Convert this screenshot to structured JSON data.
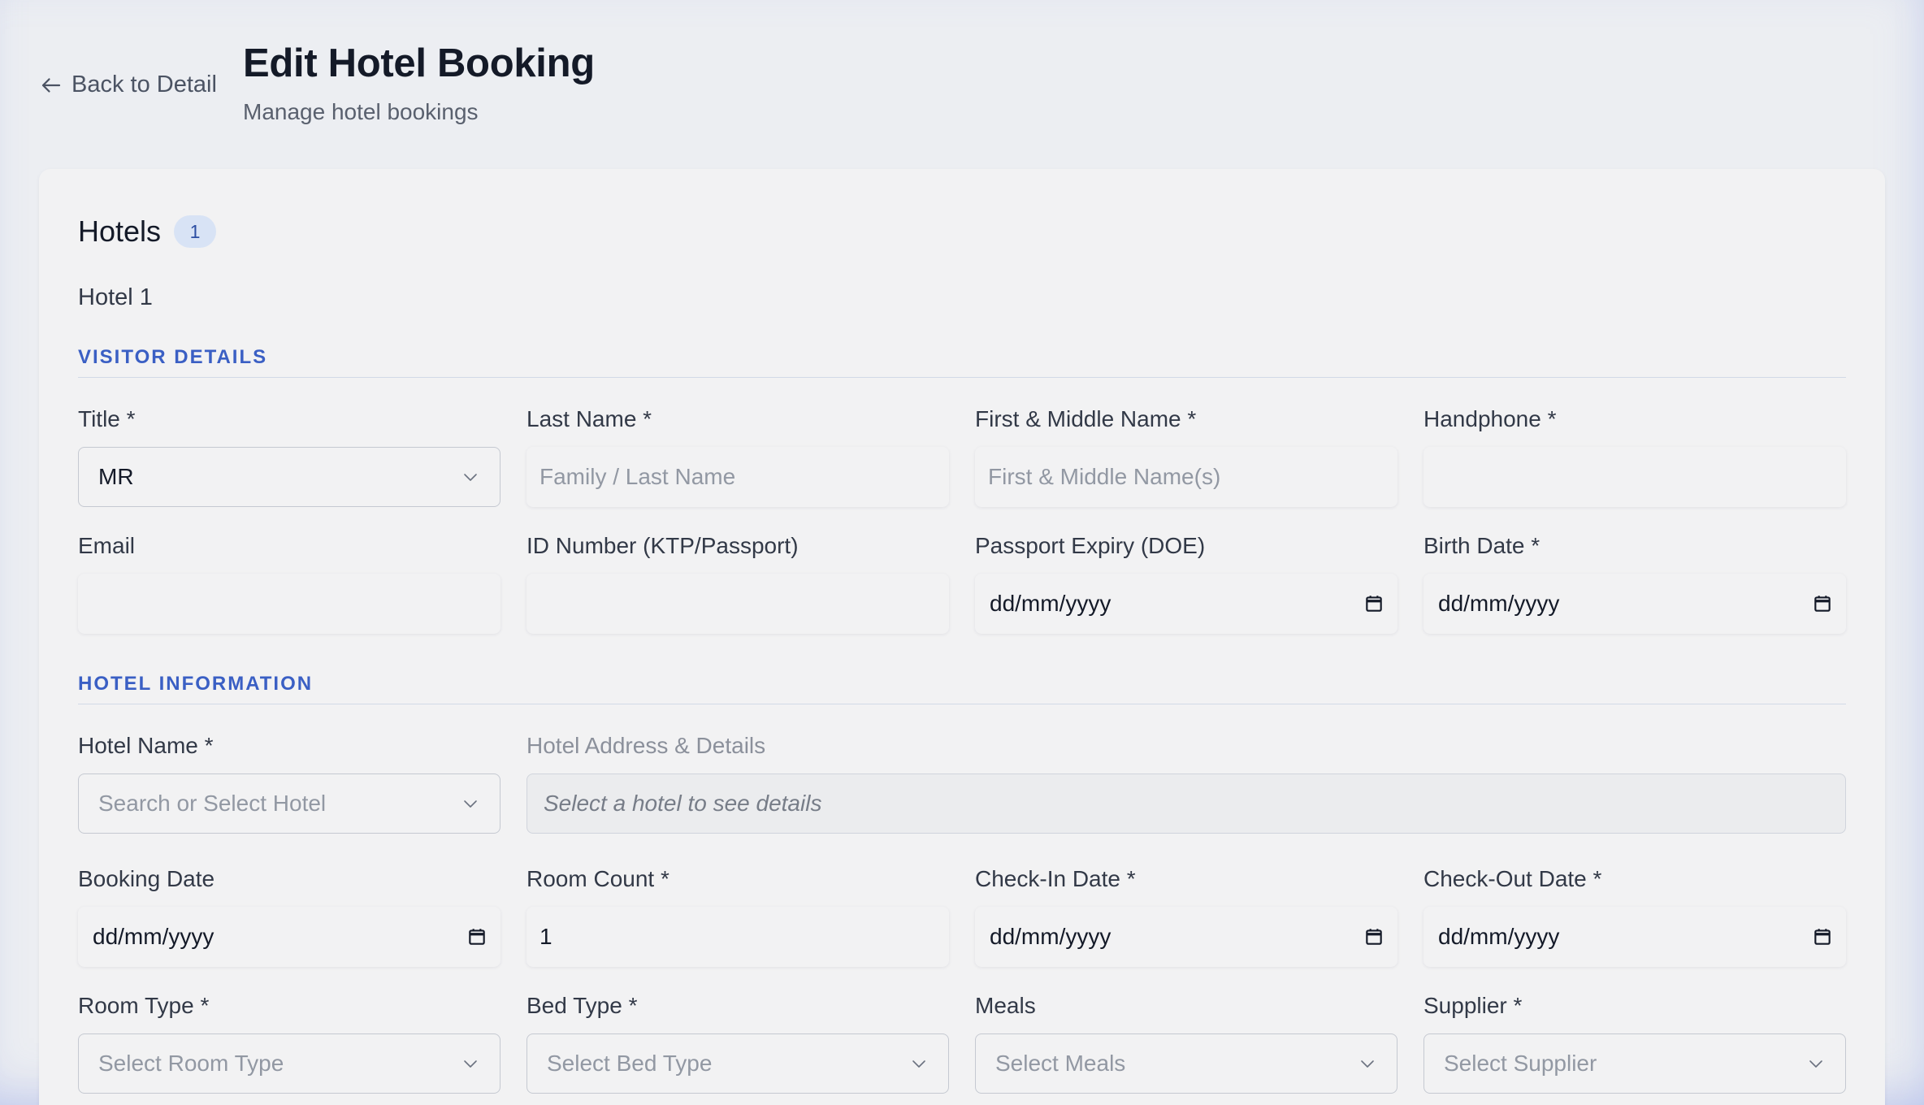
{
  "header": {
    "back_label": "Back to Detail",
    "title": "Edit Hotel Booking",
    "subtitle": "Manage hotel bookings"
  },
  "hotels": {
    "title": "Hotels",
    "count": "1",
    "item_label": "Hotel 1"
  },
  "visitor": {
    "heading": "VISITOR DETAILS",
    "title_label": "Title *",
    "title_value": "MR",
    "last_name_label": "Last Name *",
    "last_name_placeholder": "Family / Last Name",
    "first_name_label": "First & Middle Name *",
    "first_name_placeholder": "First & Middle Name(s)",
    "handphone_label": "Handphone *",
    "email_label": "Email",
    "id_label": "ID Number (KTP/Passport)",
    "passport_expiry_label": "Passport Expiry (DOE)",
    "passport_expiry_value": "dd/mm/yyyy",
    "birth_date_label": "Birth Date *",
    "birth_date_value": "dd/mm/yyyy"
  },
  "hotel_info": {
    "heading": "HOTEL INFORMATION",
    "hotel_name_label": "Hotel Name *",
    "hotel_name_placeholder": "Search or Select Hotel",
    "address_label": "Hotel Address & Details",
    "address_placeholder": "Select a hotel to see details",
    "booking_date_label": "Booking Date",
    "booking_date_value": "dd/mm/yyyy",
    "room_count_label": "Room Count *",
    "room_count_value": "1",
    "check_in_label": "Check-In Date *",
    "check_in_value": "dd/mm/yyyy",
    "check_out_label": "Check-Out Date *",
    "check_out_value": "dd/mm/yyyy",
    "room_type_label": "Room Type *",
    "room_type_placeholder": "Select Room Type",
    "bed_type_label": "Bed Type *",
    "bed_type_placeholder": "Select Bed Type",
    "meals_label": "Meals",
    "meals_placeholder": "Select Meals",
    "supplier_label": "Supplier *",
    "supplier_placeholder": "Select Supplier"
  },
  "colors": {
    "accent": "#3a5fc4",
    "background": "#eceef2",
    "card": "#f2f2f3",
    "badge_bg": "#d8e3f5"
  },
  "icons": {
    "back": "arrow-left-icon",
    "select": "chevron-down-icon",
    "date": "calendar-icon"
  }
}
